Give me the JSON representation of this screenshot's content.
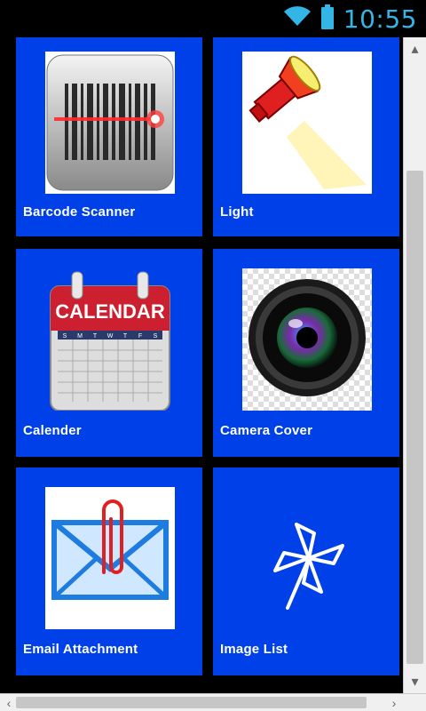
{
  "status_bar": {
    "time": "10:55",
    "icons": [
      "wifi-icon",
      "battery-icon"
    ],
    "accent_color": "#33b5e5"
  },
  "grid": {
    "tile_color": "#0040e8",
    "tiles": [
      {
        "label": "Barcode Scanner",
        "icon": "barcode-scanner-icon"
      },
      {
        "label": "Light",
        "icon": "flashlight-icon"
      },
      {
        "label": "Calender",
        "icon": "calendar-icon",
        "icon_text": "CALENDAR",
        "weekdays": [
          "S",
          "M",
          "T",
          "W",
          "T",
          "F",
          "S"
        ]
      },
      {
        "label": "Camera Cover",
        "icon": "camera-lens-icon"
      },
      {
        "label": "Email Attachment",
        "icon": "email-attachment-icon"
      },
      {
        "label": "Image List",
        "icon": "pinwheel-icon"
      }
    ]
  },
  "scrollbars": {
    "vertical": {
      "up": "▴",
      "down": "▾"
    },
    "horizontal": {
      "left": "‹",
      "right": "›"
    }
  }
}
